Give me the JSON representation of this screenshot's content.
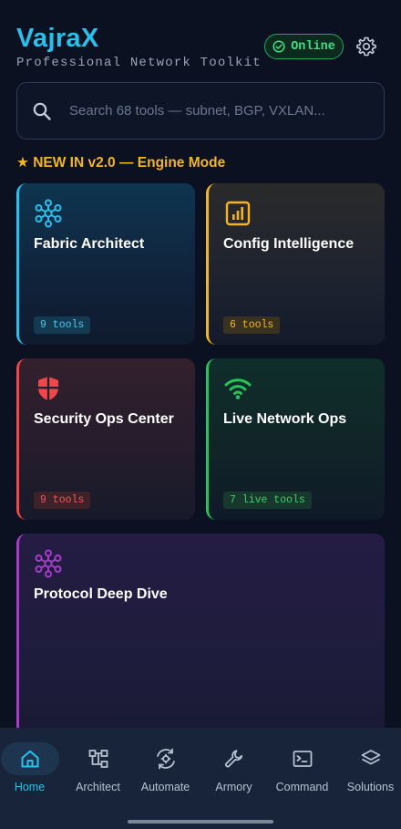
{
  "header": {
    "title": "VajraX",
    "subtitle": "Professional Network Toolkit",
    "status": "Online"
  },
  "search": {
    "placeholder": "Search 68 tools — subnet, BGP, VXLAN..."
  },
  "banner": "★ NEW IN v2.0 — Engine Mode",
  "cards": {
    "fabric": {
      "title": "Fabric Architect",
      "badge": "9 tools",
      "icon": "network-hub-icon"
    },
    "config": {
      "title": "Config Intelligence",
      "badge": "6 tools",
      "icon": "chart-box-icon"
    },
    "security": {
      "title": "Security Ops Center",
      "badge": "9 tools",
      "icon": "shield-icon"
    },
    "live": {
      "title": "Live Network Ops",
      "badge": "7 live tools",
      "icon": "wifi-icon"
    },
    "protocol": {
      "title": "Protocol Deep Dive",
      "icon": "network-hub-icon"
    }
  },
  "nav": {
    "home": "Home",
    "architect": "Architect",
    "automate": "Automate",
    "armory": "Armory",
    "command": "Command",
    "solutions": "Solutions"
  },
  "colors": {
    "accent": "#29c0ec",
    "amber": "#f4b524",
    "red": "#f0484a",
    "green": "#27c45a",
    "purple": "#a43ec6",
    "background": "#0b1120"
  }
}
